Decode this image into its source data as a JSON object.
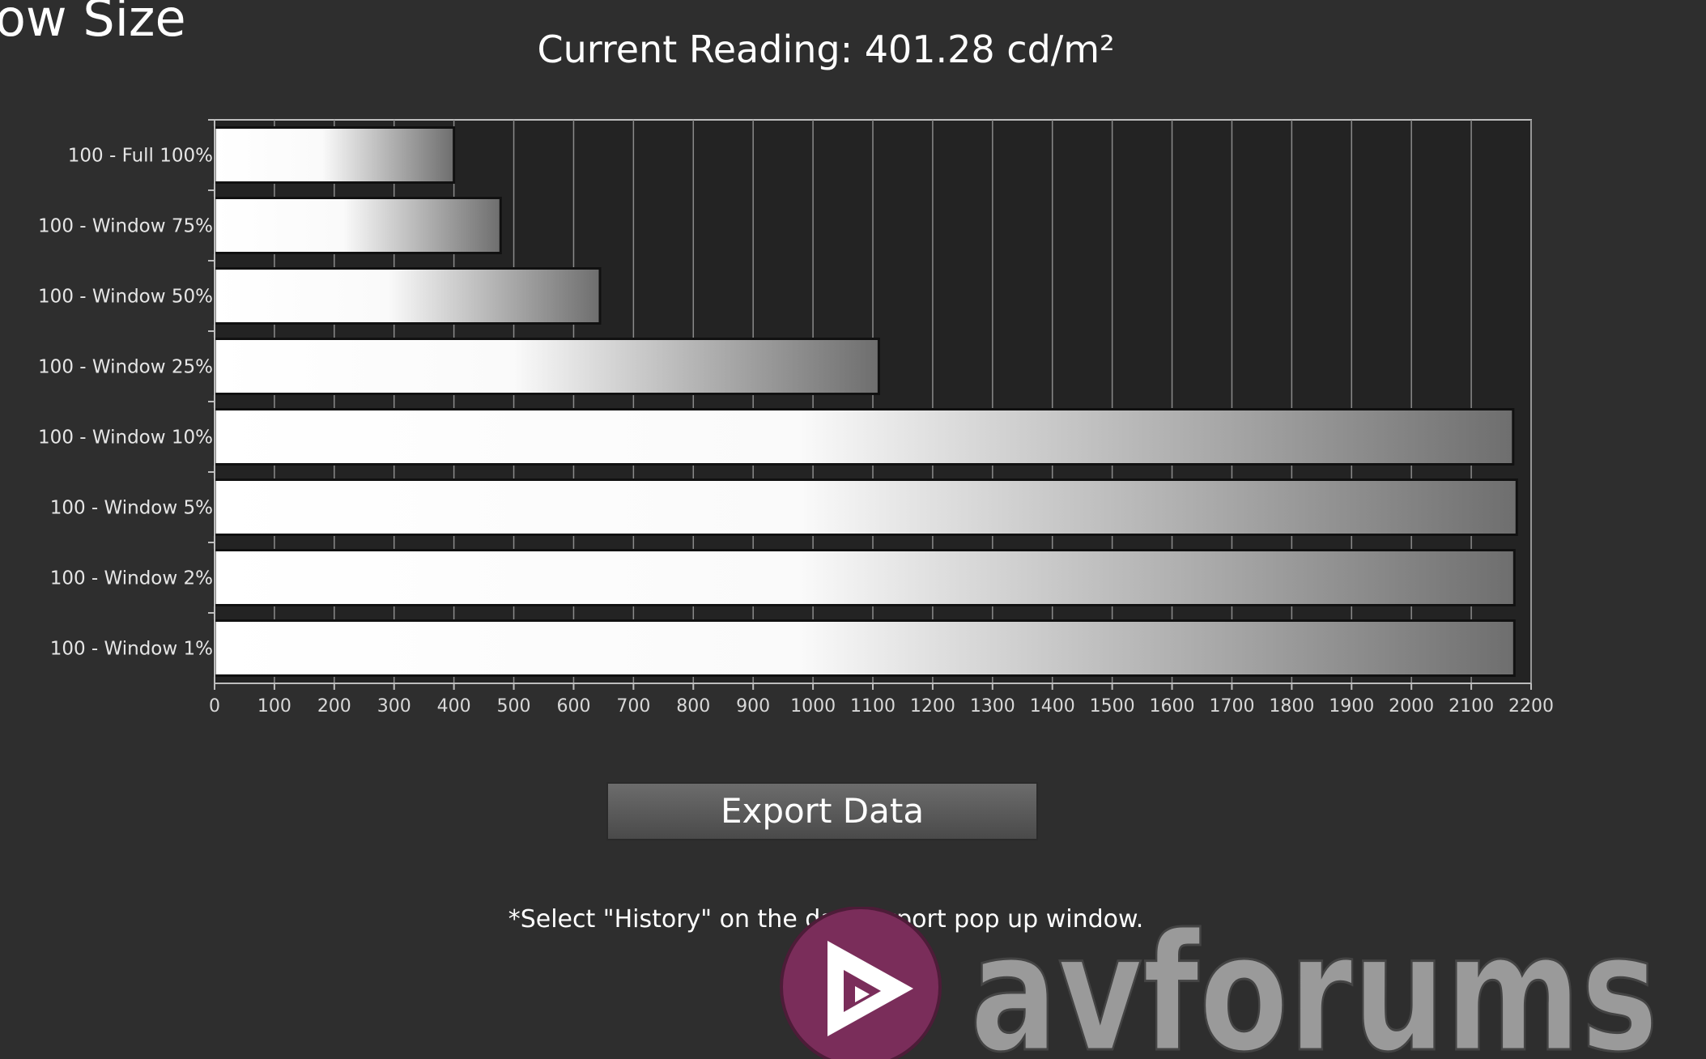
{
  "page": {
    "heading": "ow Size",
    "reading": "Current Reading: 401.28 cd/m²",
    "export_label": "Export  Data",
    "note": "*Select \"History\" on the data export pop up window.",
    "watermark_text": "avforums",
    "watermark_icon": "play-icon",
    "colors": {
      "background": "#2e2e2e",
      "plot_background": "#232323",
      "bar_light": "#ffffff",
      "bar_dark": "#6e6e6e",
      "logo_circle": "#7a2d5a",
      "logo_text": "#9a9a9a"
    }
  },
  "chart_data": {
    "type": "bar",
    "orientation": "horizontal",
    "title": "Current Reading: 401.28 cd/m²",
    "xlabel": "",
    "ylabel": "",
    "categories": [
      "100 - Full  100%",
      "100 - Window 75%",
      "100 - Window 50%",
      "100 - Window 25%",
      "100 - Window 10%",
      "100 - Window  5%",
      "100 - Window  2%",
      "100 - Window  1%"
    ],
    "values": [
      400,
      478,
      644,
      1110,
      2170,
      2176,
      2172,
      2172
    ],
    "xlim": [
      0,
      2200
    ],
    "xticks": [
      0,
      100,
      200,
      300,
      400,
      500,
      600,
      700,
      800,
      900,
      1000,
      1100,
      1200,
      1300,
      1400,
      1500,
      1600,
      1700,
      1800,
      1900,
      2000,
      2100,
      2200
    ],
    "grid": true,
    "legend": "none"
  }
}
